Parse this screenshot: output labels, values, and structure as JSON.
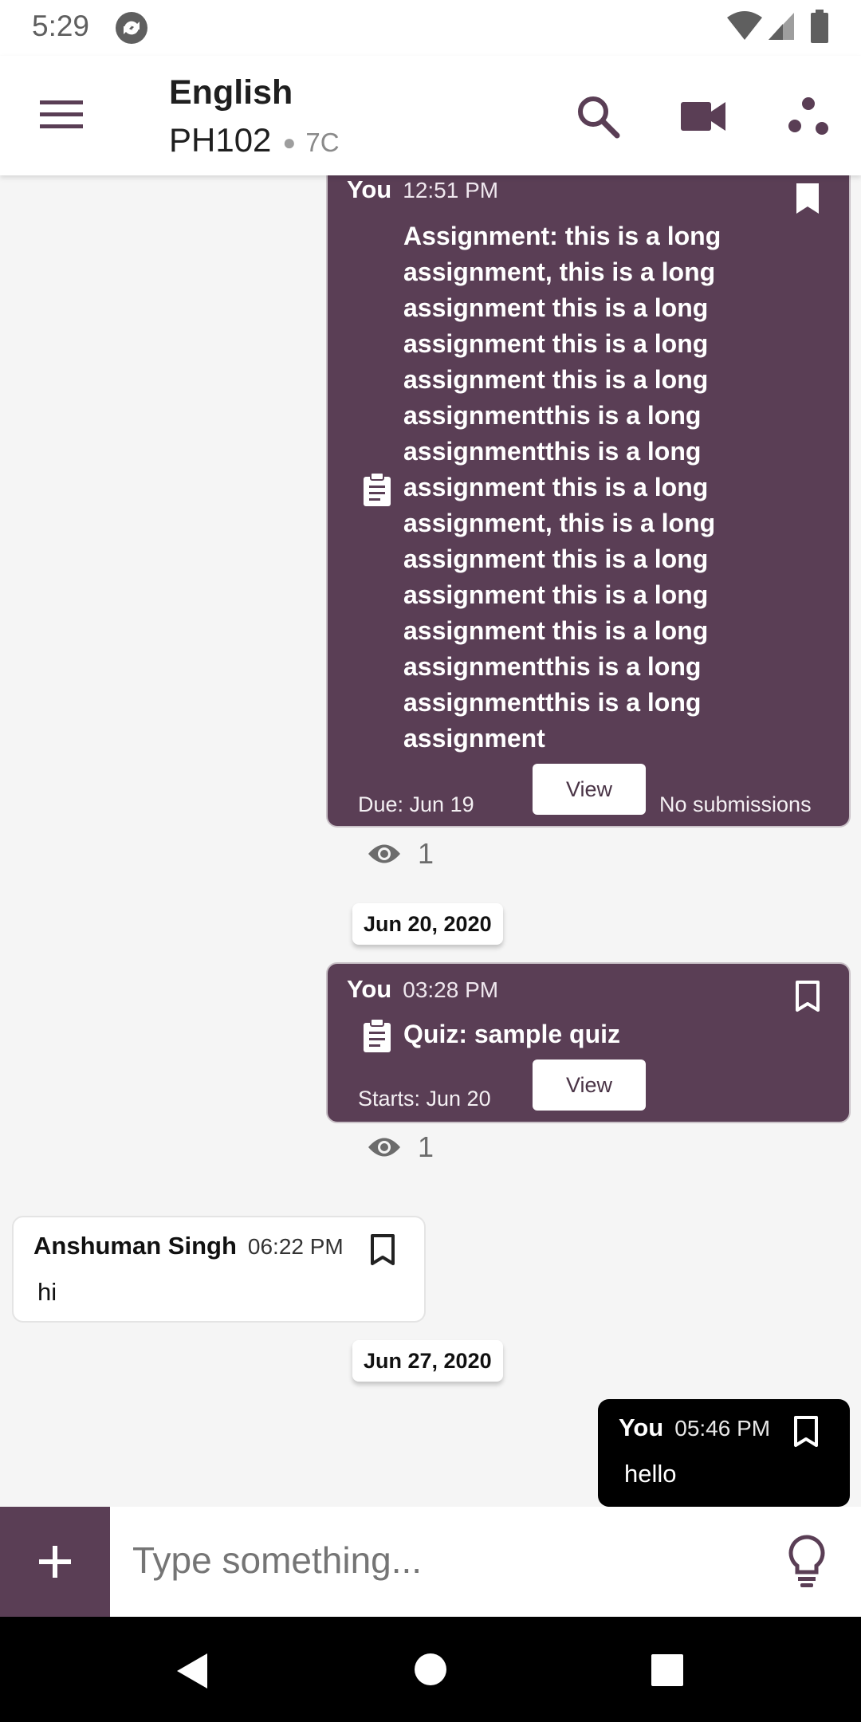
{
  "status_bar": {
    "time": "5:29"
  },
  "header": {
    "title": "English",
    "subtitle": "PH102",
    "section": "7C"
  },
  "colors": {
    "accent": "#5a3e55",
    "outgoing_bubble": "#000000"
  },
  "icons": [
    "menu-icon",
    "search-icon",
    "video-icon",
    "share-icon",
    "bookmark-icon",
    "clipboard-icon",
    "eye-icon",
    "plus-icon",
    "lightbulb-icon"
  ],
  "messages": [
    {
      "sender": "You",
      "time": "12:51 PM",
      "text": "Assignment: this is a long assignment, this is a long assignment this is a long assignment this is a long assignment this is a long assignmentthis is a long assignmentthis is a long assignment this is a long assignment, this is a long assignment this is a long assignment this is a long assignment this is a long assignmentthis is a long assignmentthis is a long assignment",
      "lines": [
        "Assignment: this is a long",
        "assignment, this is a long",
        "assignment this is a long",
        "assignment this is a long",
        "assignment this is a long",
        "assignmentthis is a long",
        "assignmentthis is a long",
        "assignment this is a long",
        "assignment, this is a long",
        "assignment this is a long",
        "assignment this is a long",
        "assignment this is a long",
        "assignmentthis is a long",
        "assignmentthis is a long",
        "assignment"
      ],
      "due": "Due:  Jun 19",
      "view_label": "View",
      "submissions": "No submissions",
      "seen_count": "1"
    },
    {
      "date_chip": "Jun 20, 2020"
    },
    {
      "sender": "You",
      "time": "03:28 PM",
      "text": "Quiz: sample quiz",
      "starts": "Starts:  Jun 20",
      "view_label": "View",
      "seen_count": "1"
    },
    {
      "sender": "Anshuman Singh",
      "time": "06:22 PM",
      "text": "hi"
    },
    {
      "date_chip": "Jun 27, 2020"
    },
    {
      "sender": "You",
      "time": "05:46 PM",
      "text": "hello"
    }
  ],
  "composer": {
    "placeholder": "Type something..."
  }
}
